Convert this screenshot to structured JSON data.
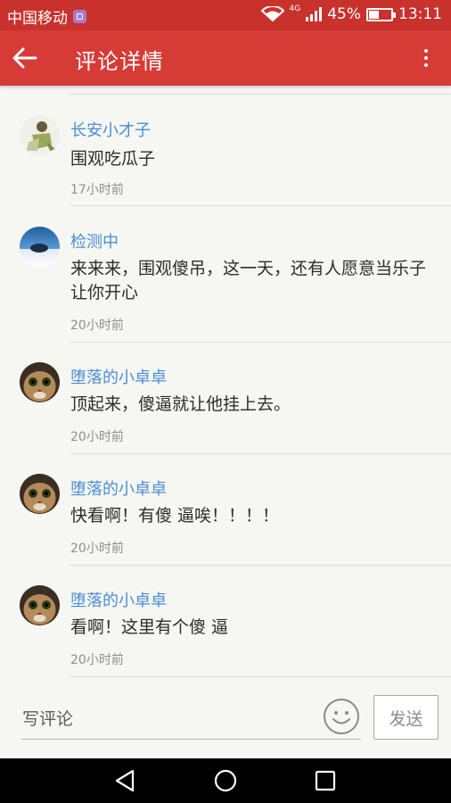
{
  "status_bar": {
    "carrier": "中国移动",
    "network": "4G",
    "battery_text": "45%",
    "battery_level": 0.45,
    "time": "13:11"
  },
  "toolbar": {
    "title": "评论详情",
    "back_icon": "arrow-left-icon",
    "more_icon": "more-vertical-icon"
  },
  "comments": [
    {
      "user": "长安小才子",
      "text": "围观吃瓜子",
      "time": "17小时前",
      "avatar": "avatar-cartoon-figure"
    },
    {
      "user": "检测中",
      "text": "来来来，围观傻吊，这一天，还有人愿意当乐子让你开心",
      "time": "20小时前",
      "avatar": "avatar-snowy-tree"
    },
    {
      "user": "堕落的小卓卓",
      "text": "顶起来，傻逼就让他挂上去。",
      "time": "20小时前",
      "avatar": "avatar-cat"
    },
    {
      "user": "堕落的小卓卓",
      "text": "快看啊！有傻 逼唉！！！！",
      "time": "20小时前",
      "avatar": "avatar-cat"
    },
    {
      "user": "堕落的小卓卓",
      "text": "看啊！这里有个傻 逼",
      "time": "20小时前",
      "avatar": "avatar-cat"
    }
  ],
  "input_bar": {
    "placeholder": "写评论",
    "emoji_icon": "smiley-icon",
    "send_label": "发送"
  },
  "nav_bar": {
    "icons": [
      "back-triangle-icon",
      "home-circle-icon",
      "recents-square-icon"
    ]
  },
  "colors": {
    "status_bar": "#c9312c",
    "toolbar": "#d63b35",
    "username": "#4a8fd3",
    "background": "#f6f7f2"
  }
}
